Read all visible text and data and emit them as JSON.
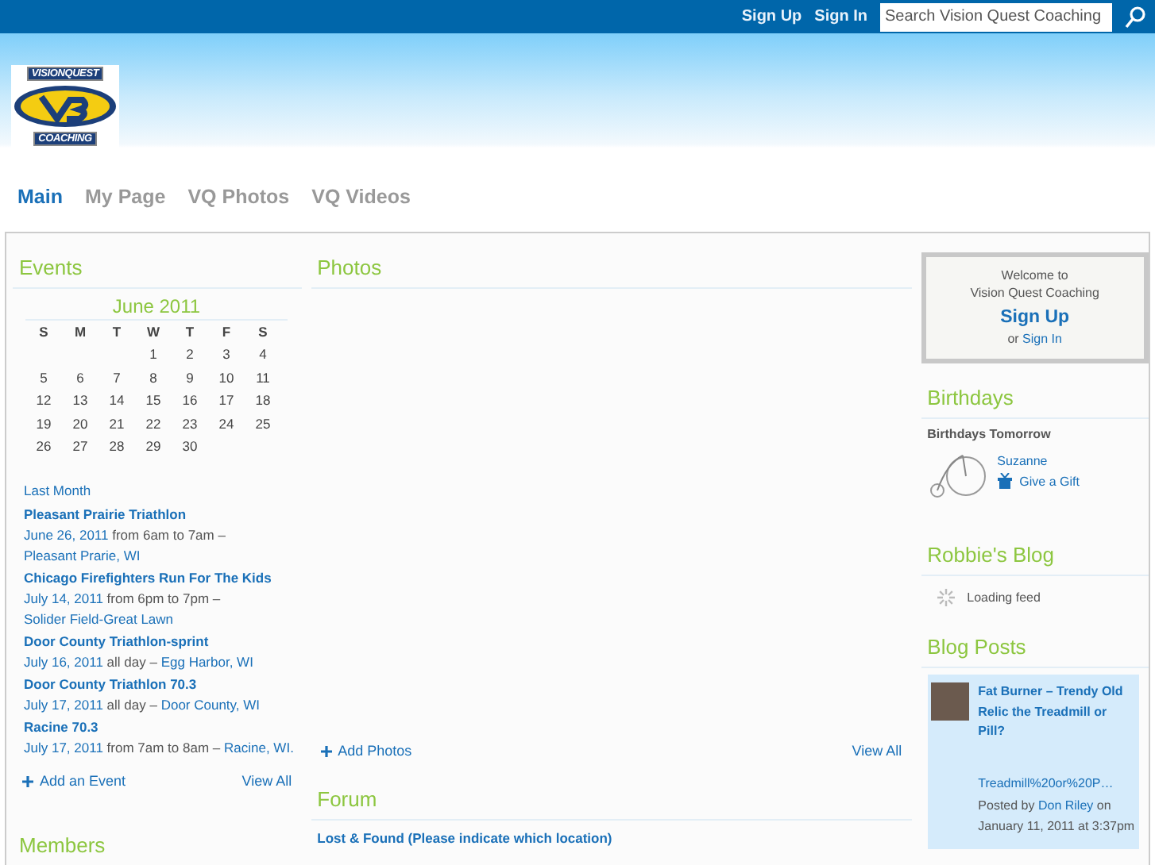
{
  "top_bar": {
    "links": [
      "Sign Up",
      "Sign In"
    ],
    "search": {
      "placeholder": "Search Vision Quest Coaching"
    }
  },
  "logo": {
    "top_text": "VISIONQUEST",
    "bottom_text": "COACHING"
  },
  "nav": [
    {
      "label": "Main",
      "selected": true
    },
    {
      "label": "My Page",
      "selected": false
    },
    {
      "label": "VQ Photos",
      "selected": false
    },
    {
      "label": "VQ Videos",
      "selected": false
    }
  ],
  "events": {
    "title": "Events",
    "calendar": {
      "month": "June 2011",
      "weekdays": [
        "S",
        "M",
        "T",
        "W",
        "T",
        "F",
        "S"
      ],
      "weeks": [
        [
          "1",
          "2",
          "3",
          "4"
        ],
        [
          "5",
          "6",
          "7",
          "8",
          "9",
          "10",
          "11"
        ],
        [
          "12",
          "13",
          "14",
          "15",
          "16",
          "17",
          "18"
        ],
        [
          "19",
          "20",
          "21",
          "22",
          "23",
          "24",
          "25"
        ],
        [
          "26",
          "27",
          "28",
          "29",
          "30"
        ]
      ]
    },
    "last_month": "Last Month",
    "items": [
      {
        "title": "Pleasant Prairie Triathlon",
        "date": "June 26, 2011",
        "time": "from 6am to 7am –",
        "location": "Pleasant Prarie, WI"
      },
      {
        "title": "Chicago Firefighters Run For The Kids",
        "date": "July 14, 2011",
        "time": "from 6pm to 7pm –",
        "location": "Solider Field-Great Lawn"
      },
      {
        "title": "Door County Triathlon-sprint",
        "date": "July 16, 2011",
        "time": "all day –",
        "location": "Egg Harbor, WI"
      },
      {
        "title": "Door County Triathlon 70.3",
        "date": "July 17, 2011",
        "time": "all day –",
        "location": "Door County, WI"
      },
      {
        "title": "Racine 70.3",
        "date": "July 17, 2011",
        "time": "from 7am to 8am –",
        "location": "Racine, WI."
      }
    ],
    "add": "Add an Event",
    "view_all": "View All"
  },
  "members": {
    "title": "Members"
  },
  "photos": {
    "title": "Photos",
    "add": "Add Photos",
    "view_all": "View All"
  },
  "forum": {
    "title": "Forum",
    "topics": [
      "Lost & Found (Please indicate which location)"
    ]
  },
  "welcome": {
    "lines": [
      "Welcome to",
      "Vision Quest Coaching"
    ],
    "sign_up": "Sign Up",
    "or": "or",
    "sign_in": "Sign In"
  },
  "birthdays": {
    "title": "Birthdays",
    "subtitle": "Birthdays Tomorrow",
    "people": [
      {
        "name": "Suzanne",
        "gift": "Give a Gift"
      }
    ]
  },
  "blog": {
    "title": "Robbie's Blog",
    "status": "Loading feed"
  },
  "blog_posts": {
    "title": "Blog Posts",
    "posts": [
      {
        "title": "Fat Burner – Trendy Old Relic the Treadmill or Pill?",
        "excerpt": "Treadmill%20or%20P…",
        "posted_by": "Posted by",
        "author": "Don Riley",
        "date": "on January 11, 2011 at 3:37pm"
      }
    ]
  }
}
